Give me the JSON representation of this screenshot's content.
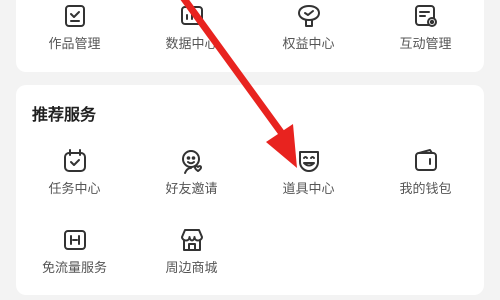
{
  "top_section": {
    "items": [
      {
        "label": "作品管理",
        "icon": "works-management-icon"
      },
      {
        "label": "数据中心",
        "icon": "data-center-icon"
      },
      {
        "label": "权益中心",
        "icon": "rights-center-icon"
      },
      {
        "label": "互动管理",
        "icon": "interaction-management-icon"
      }
    ]
  },
  "services": {
    "title": "推荐服务",
    "items": [
      {
        "label": "任务中心",
        "icon": "task-center-icon"
      },
      {
        "label": "好友邀请",
        "icon": "friend-invite-icon"
      },
      {
        "label": "道具中心",
        "icon": "props-center-icon"
      },
      {
        "label": "我的钱包",
        "icon": "wallet-icon"
      },
      {
        "label": "免流量服务",
        "icon": "data-free-icon"
      },
      {
        "label": "周边商城",
        "icon": "merch-store-icon"
      }
    ]
  },
  "annotation": {
    "arrow_color": "#e8231f"
  }
}
